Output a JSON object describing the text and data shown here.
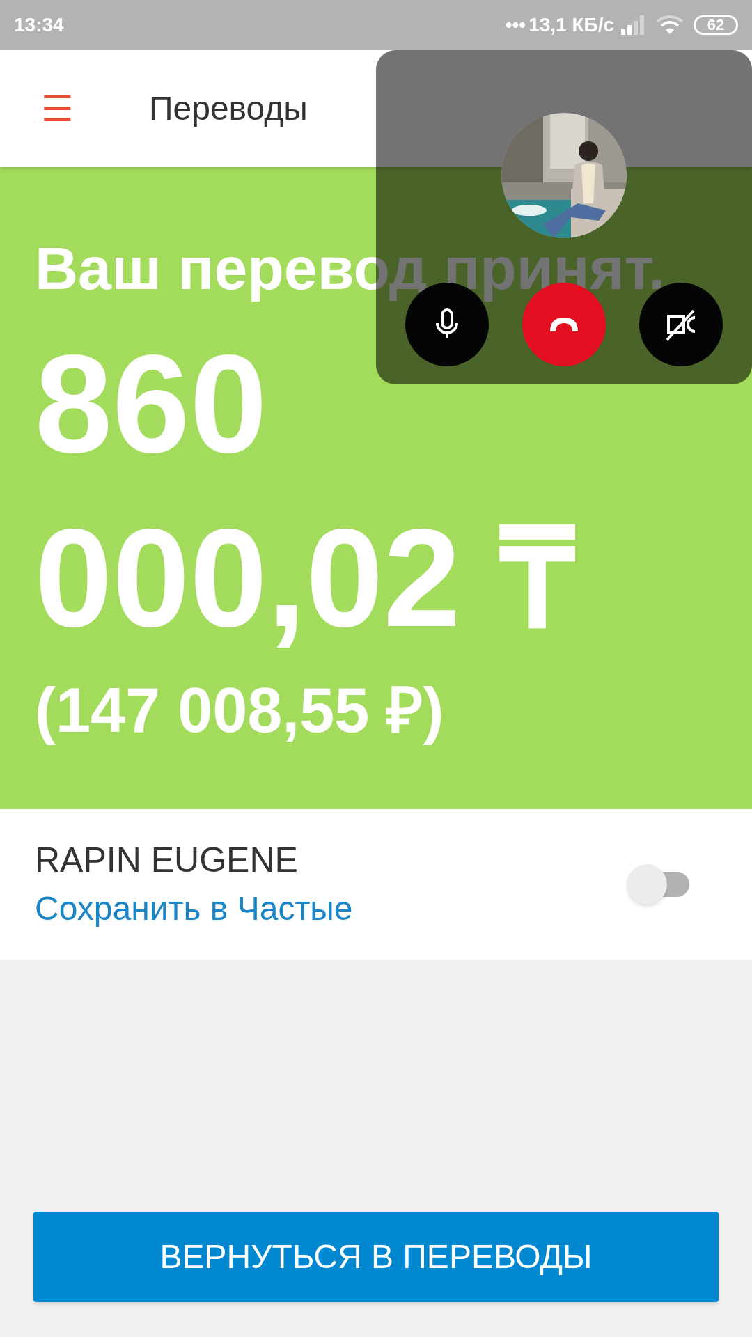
{
  "status_bar": {
    "time": "13:34",
    "dots": "•••",
    "speed": "13,1 КБ/с",
    "battery": "62"
  },
  "app_bar": {
    "menu_icon": "☰",
    "title": "Переводы"
  },
  "result": {
    "heading": "Ваш перевод принят.",
    "amount_lines": [
      "860",
      "000,02 ₸"
    ],
    "converted": "(147 008,55 ₽)"
  },
  "recipient": {
    "name": "RAPIN EUGENE",
    "save_label": "Сохранить в Частые",
    "save_toggle": {
      "on": false
    }
  },
  "call_overlay": {
    "buttons": [
      {
        "kind": "mic"
      },
      {
        "kind": "hangup"
      },
      {
        "kind": "camera-off"
      }
    ]
  },
  "footer_button": "ВЕРНУТЬСЯ В ПЕРЕВОДЫ"
}
